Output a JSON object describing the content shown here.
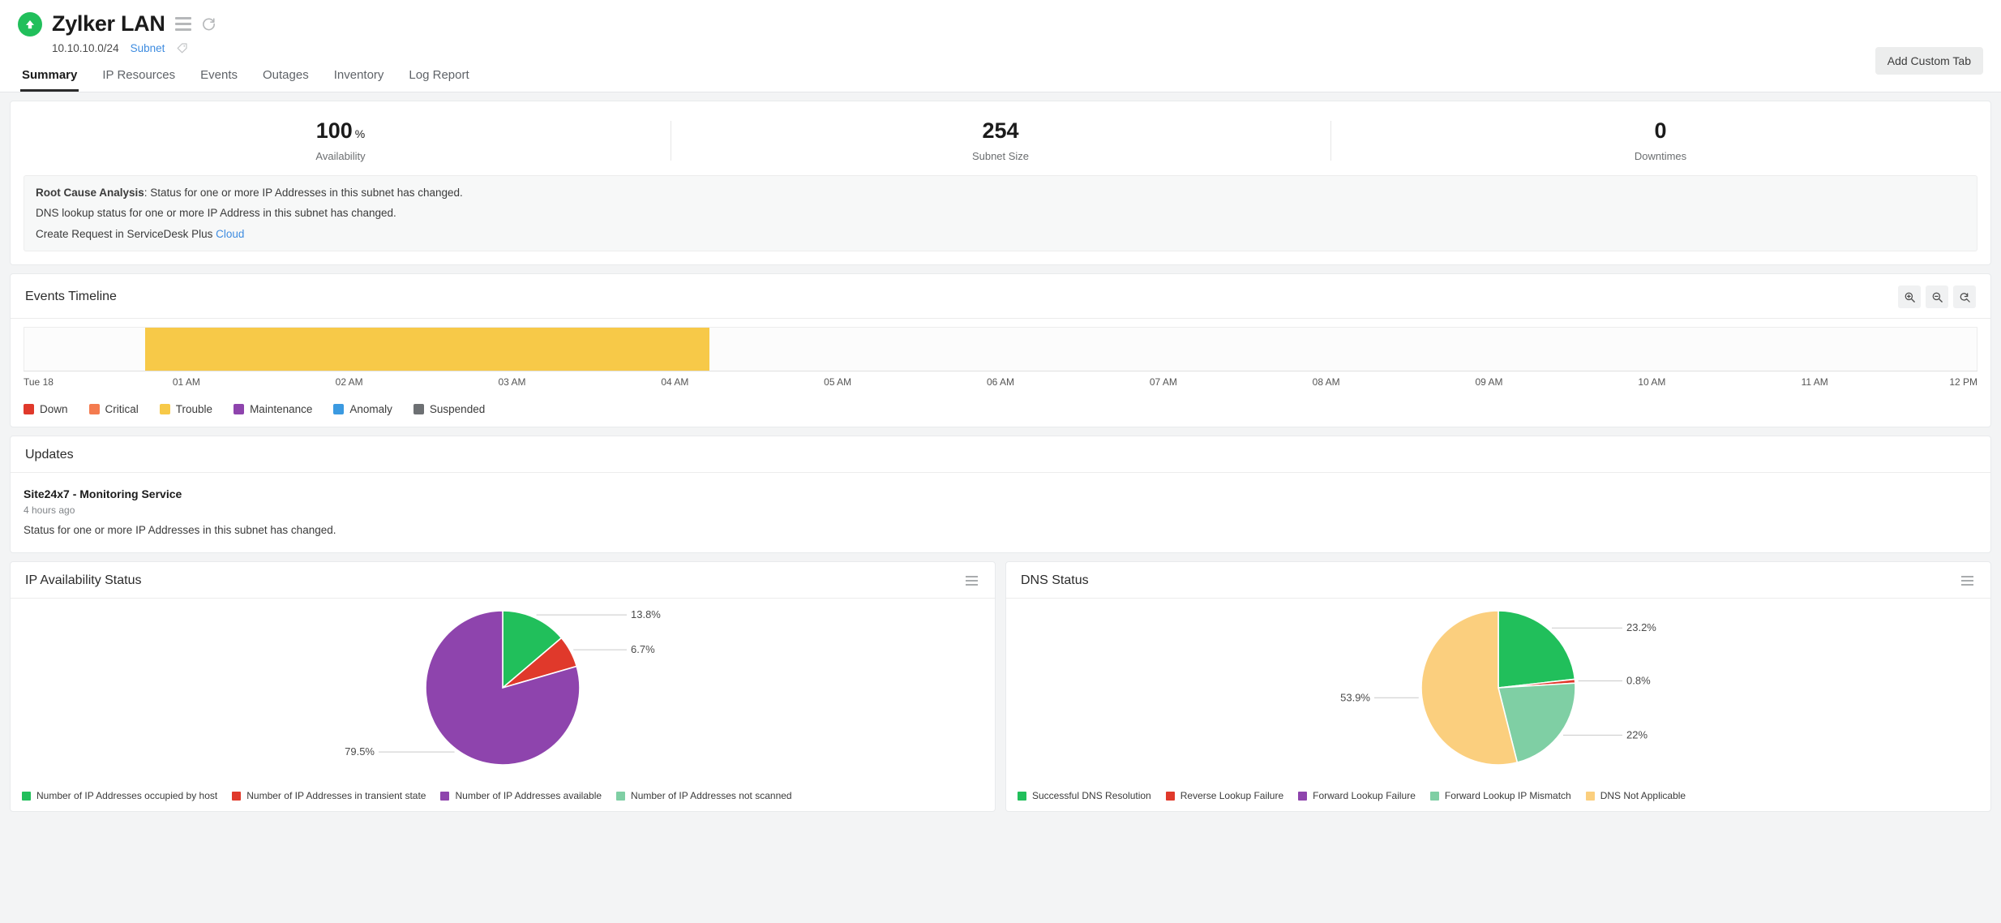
{
  "header": {
    "title": "Zylker LAN",
    "status_icon": "up-arrow-status-icon",
    "status_color": "#21bf5b",
    "menu_icon": "hamburger-menu-icon",
    "refresh_icon": "refresh-icon",
    "subnet_cidr": "10.10.10.0/24",
    "subnet_type": "Subnet",
    "tag_icon": "tag-icon",
    "add_custom_tab_label": "Add Custom Tab",
    "tabs": [
      {
        "label": "Summary",
        "active": true
      },
      {
        "label": "IP Resources",
        "active": false
      },
      {
        "label": "Events",
        "active": false
      },
      {
        "label": "Outages",
        "active": false
      },
      {
        "label": "Inventory",
        "active": false
      },
      {
        "label": "Log Report",
        "active": false
      }
    ]
  },
  "stats": [
    {
      "value": "100",
      "unit": "%",
      "label": "Availability"
    },
    {
      "value": "254",
      "unit": "",
      "label": "Subnet Size"
    },
    {
      "value": "0",
      "unit": "",
      "label": "Downtimes"
    }
  ],
  "root_cause": {
    "label": "Root Cause Analysis",
    "line1": ": Status for one or more IP Addresses in this subnet has changed.",
    "line2": "DNS lookup status for one or more IP Address in this subnet has changed.",
    "line3_prefix": "Create Request in ServiceDesk Plus ",
    "line3_link": "Cloud"
  },
  "events_timeline": {
    "title": "Events Timeline",
    "zoom_in_icon": "zoom-in-icon",
    "zoom_out_icon": "zoom-out-icon",
    "zoom_reset_icon": "zoom-reset-icon",
    "ticks": [
      "Tue 18",
      "01 AM",
      "02 AM",
      "03 AM",
      "04 AM",
      "05 AM",
      "06 AM",
      "07 AM",
      "08 AM",
      "09 AM",
      "10 AM",
      "11 AM",
      "12 PM"
    ],
    "bars": [
      {
        "status": "Trouble",
        "color": "#f7c948",
        "start_pct": 6.2,
        "end_pct": 35.1
      }
    ],
    "legend": [
      {
        "label": "Down",
        "color": "#e0392b"
      },
      {
        "label": "Critical",
        "color": "#f47b4f"
      },
      {
        "label": "Trouble",
        "color": "#f7c948"
      },
      {
        "label": "Maintenance",
        "color": "#8e44ad"
      },
      {
        "label": "Anomaly",
        "color": "#3b9ae1"
      },
      {
        "label": "Suspended",
        "color": "#6d7073"
      }
    ]
  },
  "updates": {
    "title": "Updates",
    "items": [
      {
        "title": "Site24x7 - Monitoring Service",
        "time": "4 hours ago",
        "text": "Status for one or more IP Addresses in this subnet has changed."
      }
    ]
  },
  "chart_data": [
    {
      "type": "pie",
      "title": "IP Availability Status",
      "menu_icon": "kebab-menu-icon",
      "categories": [
        "Number of IP Addresses occupied by host",
        "Number of IP Addresses in transient state",
        "Number of IP Addresses available",
        "Number of IP Addresses not scanned"
      ],
      "values": [
        13.8,
        6.7,
        79.5,
        0
      ],
      "labels": [
        "13.8%",
        "6.7%",
        "79.5%",
        ""
      ],
      "colors": [
        "#21bf5b",
        "#e0392b",
        "#8e44ad",
        "#7fcfa4"
      ],
      "legend_position": "bottom"
    },
    {
      "type": "pie",
      "title": "DNS Status",
      "menu_icon": "kebab-menu-icon",
      "categories": [
        "Successful DNS Resolution",
        "Reverse Lookup Failure",
        "Forward Lookup Failure",
        "Forward Lookup IP Mismatch",
        "DNS Not Applicable"
      ],
      "values": [
        23.2,
        0.8,
        0,
        22,
        53.9
      ],
      "labels": [
        "23.2%",
        "0.8%",
        "",
        "22%",
        "53.9%"
      ],
      "colors": [
        "#21bf5b",
        "#e0392b",
        "#8e44ad",
        "#7fcfa4",
        "#fbcf7e"
      ],
      "legend_position": "bottom"
    }
  ]
}
